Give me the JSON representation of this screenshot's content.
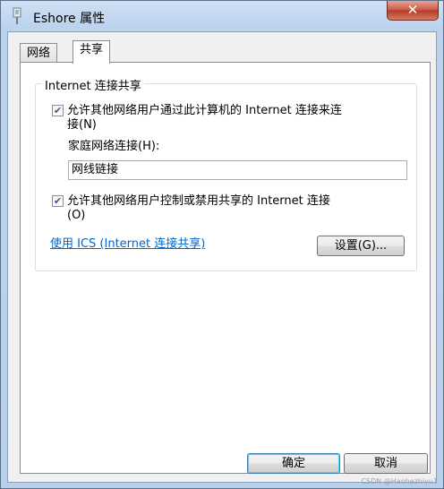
{
  "window": {
    "title": "Eshore 属性",
    "close_label": "✕"
  },
  "tabs": [
    {
      "label": "网络"
    },
    {
      "label": "共享"
    }
  ],
  "group": {
    "legend": "Internet 连接共享",
    "allow_share": {
      "checked": true,
      "label_line1": "允许其他网络用户通过此计算机的 Internet 连接来连",
      "label_line2": "接(N)"
    },
    "home_network": {
      "label": "家庭网络连接(H):",
      "value": "网线链接"
    },
    "allow_control": {
      "checked": true,
      "label_line1": "允许其他网络用户控制或禁用共享的 Internet 连接",
      "label_line2": "(O)"
    },
    "ics_link": "使用 ICS (Internet 连接共享)",
    "settings_button": "设置(G)..."
  },
  "footer": {
    "ok_button": "确定",
    "cancel_button": "取消"
  },
  "watermark": "CSDN @Haohezhiyu1",
  "colors": {
    "titlebar": "#bcd3ee",
    "link": "#0066cc",
    "close": "#c75744"
  }
}
